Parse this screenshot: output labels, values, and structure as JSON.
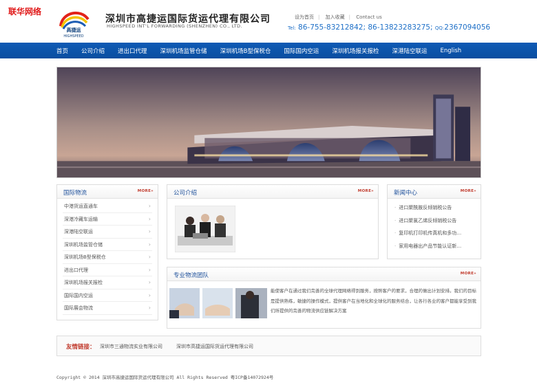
{
  "corner_mark": "联华网络",
  "brand": {
    "logo_name": "高捷运",
    "logo_sub": "HIGHSPEED",
    "company_cn": "深圳市高捷运国际货运代理有限公司",
    "company_en": "HIGHSPEED INT'L FORWARDING (SHENZHEN) CO., LTD."
  },
  "top_links": [
    "设为首页",
    "加入收藏",
    "Contact us"
  ],
  "contact": {
    "tel_label": "Tel:",
    "tel_value": "86-755-83212842; 86-13823283275;",
    "qq_label": "QQ:",
    "qq_value": "2367094056"
  },
  "nav": [
    "首页",
    "公司介绍",
    "进出口代理",
    "深圳机场监管仓储",
    "深圳机场B型保税仓",
    "国际国内空运",
    "深圳机场报关报检",
    "深港陆空联运",
    "English"
  ],
  "more_label": "MORE»",
  "intl_logistics": {
    "title": "国际物流",
    "items": [
      "中港货运直通车",
      "深港冷藏车运输",
      "深港陆空联运",
      "深圳机场监管仓储",
      "深圳机场B型保税仓",
      "进出口代理",
      "深圳机场报关报检",
      "国际国内空运",
      "国际展会物流"
    ]
  },
  "company_intro": {
    "title": "公司介绍"
  },
  "news": {
    "title": "新闻中心",
    "items": [
      "进口聚酰胺反倾销税公告",
      "进口聚氯乙烯反倾销税公告",
      "复印机打印机传真机和多功…",
      "家用电器出产品节能认证新…"
    ]
  },
  "team": {
    "title": "专业物流团队",
    "text": "能使客户在通过我们完善的全球代理网络得到服务，按照客户的要求，合理的做出计划安排。我们的目标是提供熟练，敏捷的操作模式，提供客户在当地化和全球化的服务结合，让各行各业的客户都能享受到我们所提供的完善的物流供应链解决方案"
  },
  "friend_links": {
    "label": "友情链接：",
    "items": [
      "深圳市三通物流实业有限公司",
      "深圳市高捷运国际货运代理有限公司"
    ]
  },
  "footer": "Copyright © 2014 深圳市高捷运国际货运代理有限公司 All Rights Reserved 粤ICP备14072924号"
}
